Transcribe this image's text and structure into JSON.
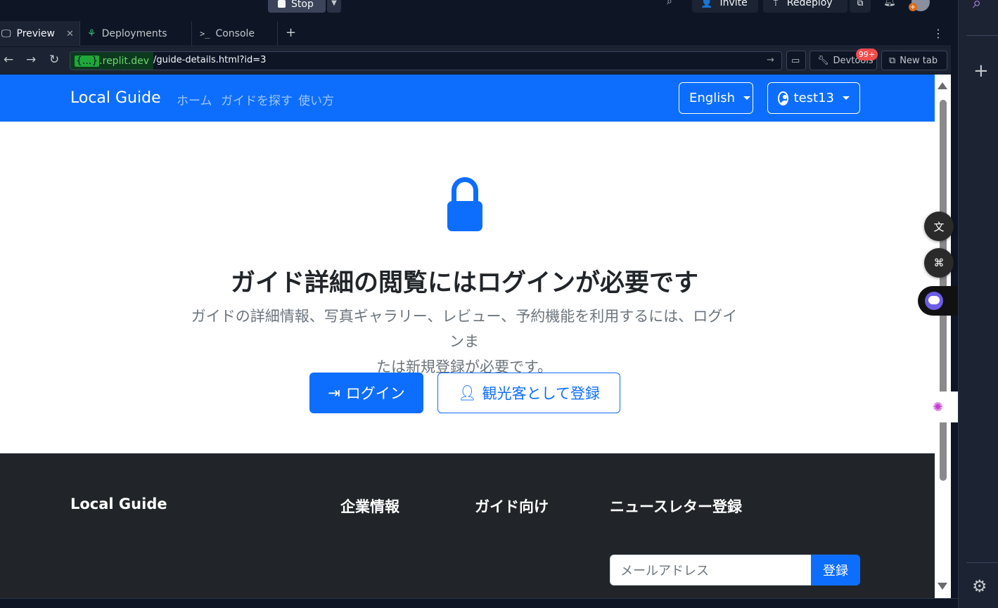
{
  "replit": {
    "stop_label": "Stop",
    "invite_label": "Invite",
    "redeploy_label": "Redeploy"
  },
  "tabs": [
    {
      "label": "Preview",
      "icon": "monitor-icon",
      "active": true
    },
    {
      "label": "Deployments",
      "icon": "deploy-tree-icon",
      "active": false
    },
    {
      "label": "Console",
      "icon": "terminal-icon",
      "active": false
    }
  ],
  "url": {
    "host": ".replit.dev",
    "host_prefix": "{...}",
    "path": "/guide-details.html?id=3"
  },
  "toolbar": {
    "devtools_label": "Devtools",
    "devtools_badge": "99+",
    "new_tab_label": "New tab"
  },
  "site": {
    "brand": "Local Guide",
    "nav": [
      "ホーム",
      "ガイドを探す",
      "使い方"
    ],
    "language": "English",
    "user": "test13"
  },
  "main": {
    "headline": "ガイド詳細の閲覧にはログインが必要です",
    "description_line1": "ガイドの詳細情報、写真ギャラリー、レビュー、予約機能を利用するには、ログインま",
    "description_line2": "たは新規登録が必要です。",
    "login_label": "ログイン",
    "register_label": "観光客として登録"
  },
  "footer": {
    "brand": "Local Guide",
    "col_company": "企業情報",
    "col_guides": "ガイド向け",
    "col_newsletter": "ニュースレター登録",
    "email_placeholder": "メールアドレス",
    "subscribe_label": "登録"
  },
  "colors": {
    "primary": "#0d6efd",
    "footer_bg": "#212529",
    "ide_bg": "#0e1525"
  }
}
